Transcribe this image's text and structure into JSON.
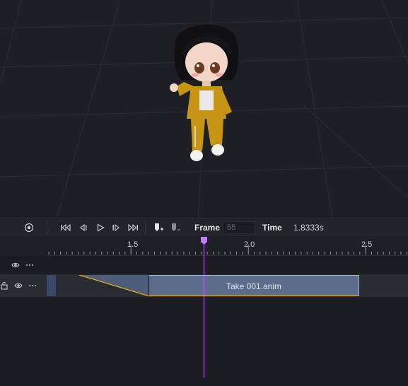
{
  "timeline": {
    "toolbar": {
      "frame_label": "Frame",
      "frame_value": "55",
      "time_label": "Time",
      "time_value": "1.8333s"
    },
    "ruler": {
      "ticks": [
        "1.5",
        "2.0",
        "2.5"
      ]
    },
    "tracks": [
      {
        "clip": "Take 001.anim"
      }
    ]
  },
  "colors": {
    "playhead": "#c27bff",
    "clip_fill": "#5b6d8a",
    "clip_border": "#e6b21a"
  }
}
